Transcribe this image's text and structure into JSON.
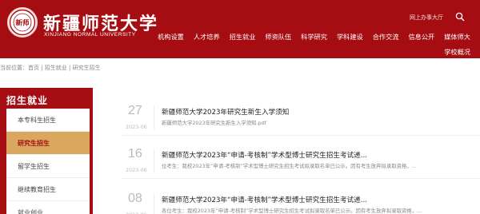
{
  "header": {
    "logo_name": "新疆师范大学",
    "logo_en": "XINJIANG NORMAL UNIVERSITY",
    "seal_text": "新师",
    "top_link": "网上办事大厅",
    "nav": [
      "机构设置",
      "人才培养",
      "招生就业",
      "师资队伍",
      "科学研究",
      "学科建设",
      "合作交流",
      "信息公开",
      "媒体师大"
    ],
    "nav_second": "学校概况"
  },
  "breadcrumb": "当前位置：首页 | 招生就业 | 研究生招生",
  "sidebar": {
    "title": "招生就业",
    "items": [
      {
        "label": "本专科生招生",
        "active": false
      },
      {
        "label": "研究生招生",
        "active": true
      },
      {
        "label": "留学生招生",
        "active": false
      },
      {
        "label": "继续教育招生",
        "active": false
      },
      {
        "label": "就业创业",
        "active": false
      }
    ]
  },
  "news": [
    {
      "day": "27",
      "month": "2023-06",
      "title": "新疆师范大学2023年研究生新生入学须知",
      "desc": "新疆师范大学2023年研究生新生入学须知.pdf"
    },
    {
      "day": "16",
      "month": "2023-06",
      "title": "新疆师范大学2023年“申请-考核制”学术型博士研究生招生考试递...",
      "desc": "位考生：我校2023年“申请-考核制”学术型博士研究生招生考试拟录取名单已公示。因有考生放弃拟录取资格，..."
    },
    {
      "day": "08",
      "month": "2023-06",
      "title": "新疆师范大学2023年“申请-考核制”学术型博士研究生招生考试递...",
      "desc": "各位考生：我校2023年“申请-考核制”学术型博士研究生招生考试拟录取名单已公示。因有考生放弃拟录取资格，..."
    }
  ],
  "colors": {
    "brand": "#a50d12",
    "active_bg": "#d9a85e"
  }
}
